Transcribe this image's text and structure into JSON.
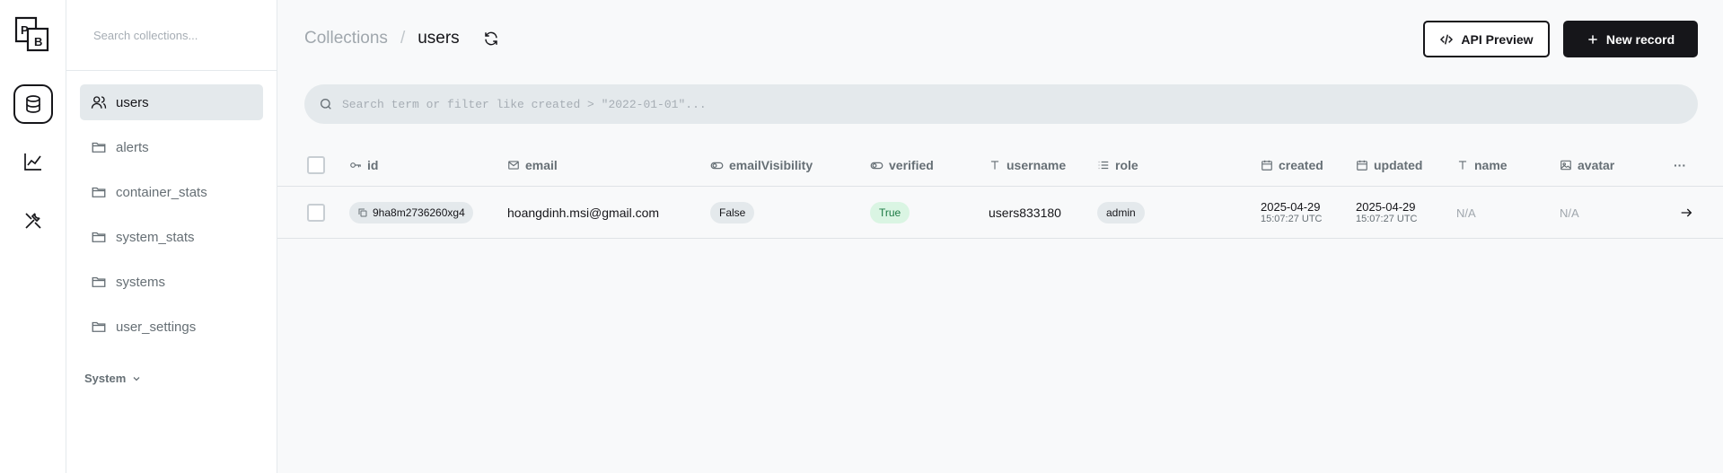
{
  "app": {
    "logo_text": "PB",
    "rail": [
      {
        "icon": "database-icon",
        "active": true
      },
      {
        "icon": "chart-line-icon",
        "active": false
      },
      {
        "icon": "tools-icon",
        "active": false
      }
    ]
  },
  "sidebar": {
    "search_placeholder": "Search collections...",
    "items": [
      {
        "label": "users",
        "icon": "users-icon",
        "active": true
      },
      {
        "label": "alerts",
        "icon": "folder-icon",
        "active": false
      },
      {
        "label": "container_stats",
        "icon": "folder-icon",
        "active": false
      },
      {
        "label": "system_stats",
        "icon": "folder-icon",
        "active": false
      },
      {
        "label": "systems",
        "icon": "folder-icon",
        "active": false
      },
      {
        "label": "user_settings",
        "icon": "folder-icon",
        "active": false
      }
    ],
    "system_label": "System"
  },
  "header": {
    "breadcrumb_root": "Collections",
    "breadcrumb_sep": "/",
    "breadcrumb_current": "users",
    "api_preview_label": "API Preview",
    "new_record_label": "New record"
  },
  "search": {
    "placeholder": "Search term or filter like created > \"2022-01-01\"..."
  },
  "table": {
    "columns": [
      {
        "key": "id",
        "label": "id",
        "icon": "key-icon"
      },
      {
        "key": "email",
        "label": "email",
        "icon": "mail-icon"
      },
      {
        "key": "emailVisibility",
        "label": "emailVisibility",
        "icon": "toggle-icon"
      },
      {
        "key": "verified",
        "label": "verified",
        "icon": "toggle-icon"
      },
      {
        "key": "username",
        "label": "username",
        "icon": "text-icon"
      },
      {
        "key": "role",
        "label": "role",
        "icon": "list-icon"
      },
      {
        "key": "created",
        "label": "created",
        "icon": "calendar-icon"
      },
      {
        "key": "updated",
        "label": "updated",
        "icon": "calendar-icon"
      },
      {
        "key": "name",
        "label": "name",
        "icon": "text-icon"
      },
      {
        "key": "avatar",
        "label": "avatar",
        "icon": "image-icon"
      }
    ],
    "more_label": "···",
    "rows": [
      {
        "id": "9ha8m2736260xg4",
        "email": "hoangdinh.msi@gmail.com",
        "emailVisibility": "False",
        "verified": "True",
        "username": "users833180",
        "role": "admin",
        "created_date": "2025-04-29",
        "created_time": "15:07:27 UTC",
        "updated_date": "2025-04-29",
        "updated_time": "15:07:27 UTC",
        "name": "N/A",
        "avatar": "N/A"
      }
    ]
  },
  "colors": {
    "accent_dark": "#16161a",
    "muted": "#666f75",
    "surface": "#e4e9ec",
    "success_bg": "#daf5e3",
    "success_fg": "#1c7a44"
  }
}
